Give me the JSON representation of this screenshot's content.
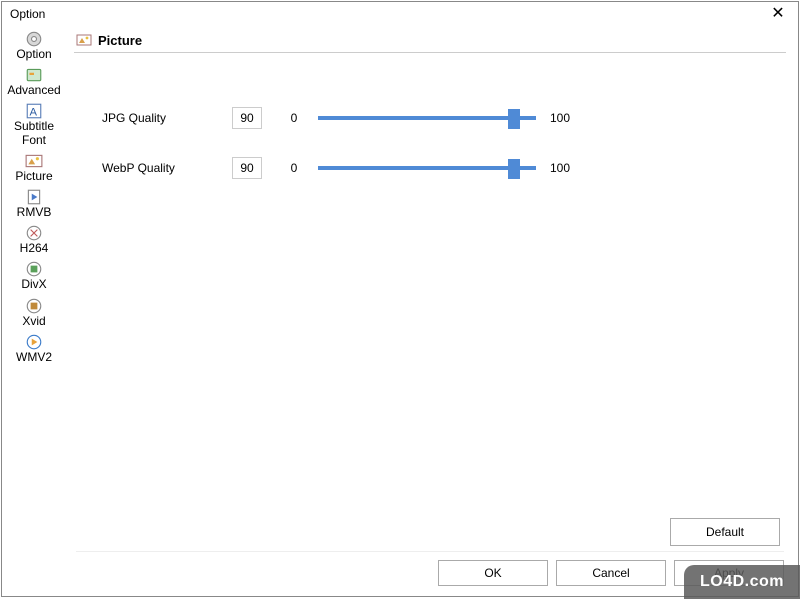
{
  "window": {
    "title": "Option",
    "close_glyph": "✕"
  },
  "sidebar": {
    "items": [
      {
        "key": "option",
        "label": "Option"
      },
      {
        "key": "advanced",
        "label": "Advanced"
      },
      {
        "key": "subtitle",
        "label": "Subtitle Font"
      },
      {
        "key": "picture",
        "label": "Picture",
        "selected": true
      },
      {
        "key": "rmvb",
        "label": "RMVB"
      },
      {
        "key": "h264",
        "label": "H264"
      },
      {
        "key": "divx",
        "label": "DivX"
      },
      {
        "key": "xvid",
        "label": "Xvid"
      },
      {
        "key": "wmv2",
        "label": "WMV2"
      }
    ]
  },
  "section": {
    "title": "Picture"
  },
  "settings": {
    "jpg": {
      "label": "JPG Quality",
      "value": "90",
      "min": "0",
      "max": "100",
      "pct": 90
    },
    "webp": {
      "label": "WebP Quality",
      "value": "90",
      "min": "0",
      "max": "100",
      "pct": 90
    }
  },
  "buttons": {
    "default": "Default",
    "ok": "OK",
    "cancel": "Cancel",
    "apply": "Apply"
  },
  "watermark": "LO4D.com"
}
